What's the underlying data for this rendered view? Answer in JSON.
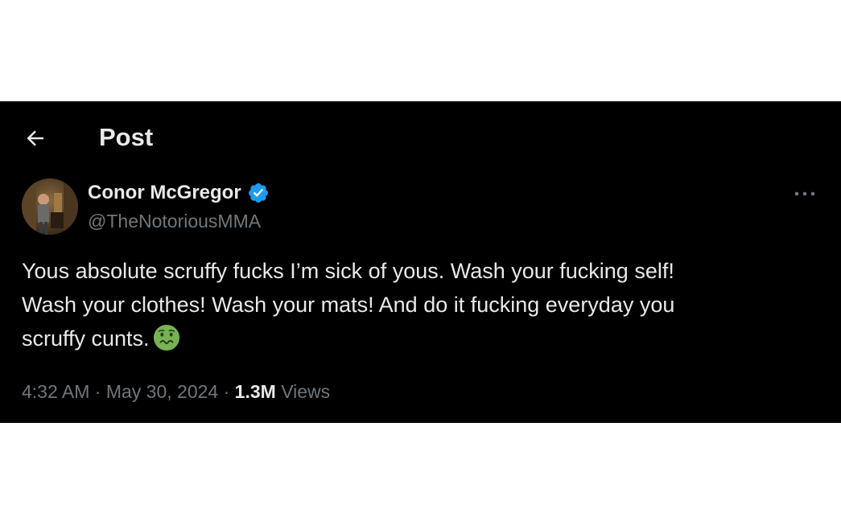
{
  "header": {
    "back_icon": "arrow-left-icon",
    "title": "Post"
  },
  "author": {
    "name": "Conor McGregor",
    "handle": "@TheNotoriousMMA",
    "verified_icon": "verified-badge-icon",
    "verified_color": "#1d9bf0"
  },
  "more_icon": "more-horizontal-icon",
  "tweet": {
    "text": "Yous absolute scruffy fucks I’m sick of yous. Wash your fucking self!\nWash your clothes! Wash your mats! And do it fucking everyday you\nscruffy cunts.",
    "emoji_icon": "nauseated-face-emoji-icon"
  },
  "meta": {
    "time": "4:32 AM",
    "separator": " · ",
    "date": "May 30, 2024",
    "views_count": "1.3M",
    "views_label": "Views"
  },
  "colors": {
    "background": "#000000",
    "text_primary": "#e7e9ea",
    "text_secondary": "#71767b",
    "accent": "#1d9bf0",
    "page_background": "#ffffff"
  }
}
